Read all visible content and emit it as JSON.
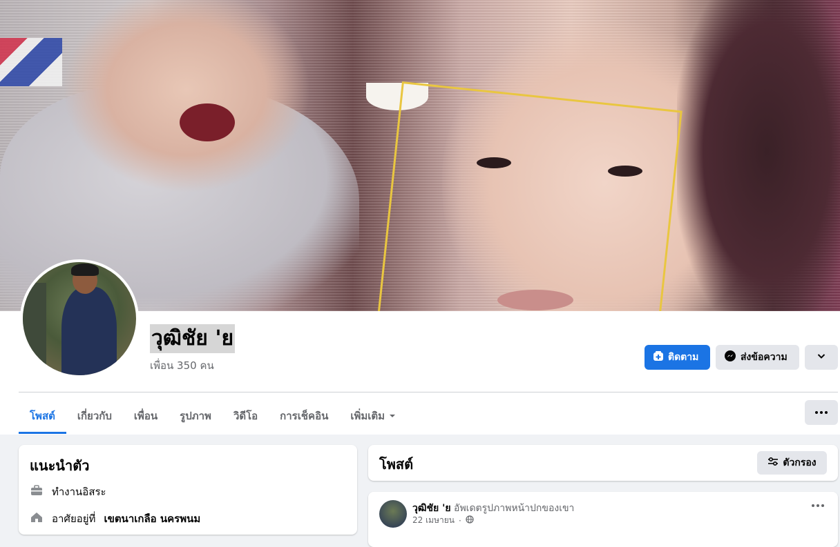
{
  "profile": {
    "name": "วุฒิชัย 'ย",
    "friends_text": "เพื่อน 350 คน"
  },
  "actions": {
    "follow_label": "ติดตาม",
    "message_label": "ส่งข้อความ"
  },
  "tabs": [
    {
      "label": "โพสต์",
      "active": true
    },
    {
      "label": "เกี่ยวกับ"
    },
    {
      "label": "เพื่อน"
    },
    {
      "label": "รูปภาพ"
    },
    {
      "label": "วิดีโอ"
    },
    {
      "label": "การเช็คอิน"
    },
    {
      "label": "เพิ่มเติม"
    }
  ],
  "intro": {
    "title": "แนะนำตัว",
    "items": [
      {
        "icon": "briefcase-icon",
        "text": "ทำงานอิสระ"
      },
      {
        "icon": "home-icon",
        "prefix": "อาศัยอยู่ที่",
        "value": "เขตนาเกลือ นครพนม"
      }
    ]
  },
  "posts_panel": {
    "title": "โพสต์",
    "filter_label": "ตัวกรอง"
  },
  "post": {
    "author": "วุฒิชัย 'ย",
    "action": "อัพเดตรูปภาพหน้าปกของเขา",
    "date": "22 เมษายน",
    "privacy_icon": "globe-icon"
  },
  "colors": {
    "accent": "#1b74e4",
    "secondary_button": "#e4e6eb",
    "page_background": "#f0f2f5"
  }
}
